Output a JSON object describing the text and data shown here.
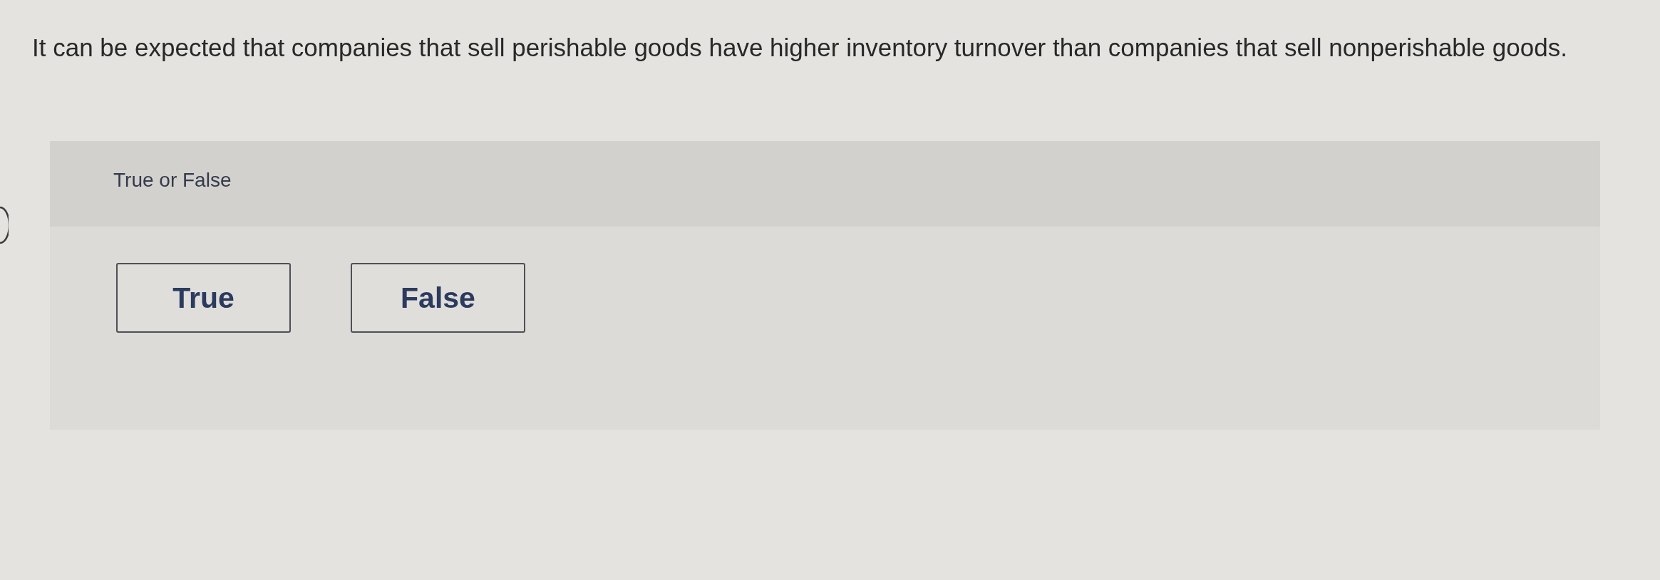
{
  "question": {
    "text": "It can be expected that companies that sell perishable goods have higher inventory turnover than companies that sell nonperishable goods."
  },
  "answer_panel": {
    "label": "True or False",
    "options": [
      {
        "label": "True",
        "selected": false
      },
      {
        "label": "False",
        "selected": false
      }
    ]
  }
}
